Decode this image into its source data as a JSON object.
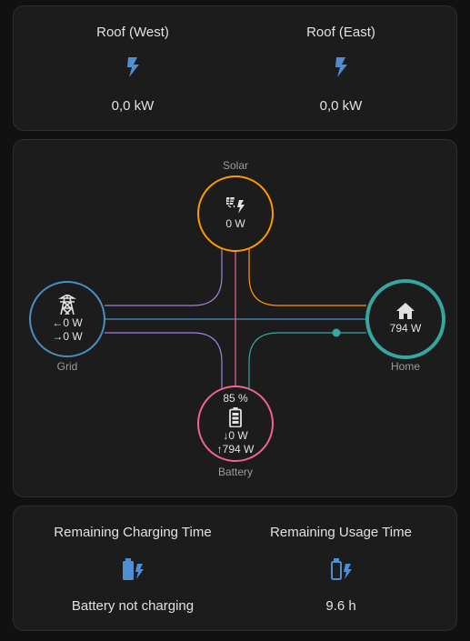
{
  "production": {
    "west": {
      "title": "Roof (West)",
      "value": "0,0 kW",
      "icon": "flash-icon"
    },
    "east": {
      "title": "Roof (East)",
      "value": "0,0 kW",
      "icon": "flash-icon"
    }
  },
  "flow": {
    "solar": {
      "label": "Solar",
      "value": "0 W",
      "icon": "solar-power-icon"
    },
    "grid": {
      "label": "Grid",
      "in": "0 W",
      "out": "0 W",
      "icon": "transmission-tower-icon"
    },
    "home": {
      "label": "Home",
      "value": "794 W",
      "icon": "home-icon"
    },
    "battery": {
      "label": "Battery",
      "percent": "85 %",
      "in": "0 W",
      "out": "794 W",
      "icon": "battery-icon"
    }
  },
  "times": {
    "charging": {
      "title": "Remaining Charging Time",
      "value": "Battery not charging",
      "icon": "battery-charging-icon"
    },
    "usage": {
      "title": "Remaining Usage Time",
      "value": "9.6 h",
      "icon": "battery-outline-charging-icon"
    }
  },
  "colors": {
    "solar": "#ff9800",
    "grid": "#488fc2",
    "home": "#35a7a0",
    "battery": "#f06292",
    "grid_flow": "#a280db",
    "icon_blue": "#4f8ed0"
  }
}
